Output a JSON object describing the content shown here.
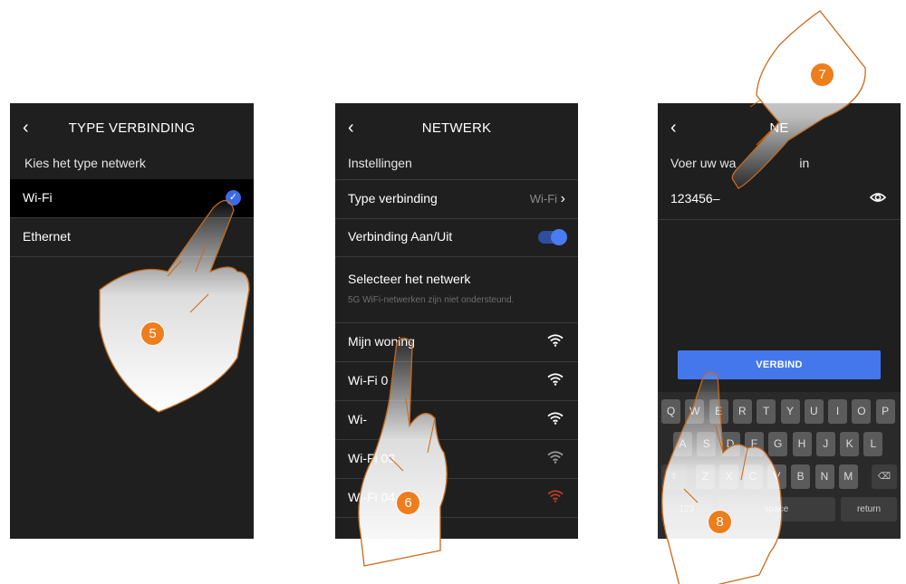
{
  "screen1": {
    "title": "TYPE VERBINDING",
    "subtitle": "Kies het type netwerk",
    "items": [
      {
        "label": "Wi-Fi",
        "selected": true
      },
      {
        "label": "Ethernet",
        "selected": false
      }
    ]
  },
  "screen2": {
    "title": "NETWERK",
    "section": "Instellingen",
    "type_label": "Type verbinding",
    "type_value": "Wi-Fi",
    "toggle_label": "Verbinding Aan/Uit",
    "toggle_on": true,
    "select_label": "Selecteer het netwerk",
    "note": "5G WiFi-netwerken zijn niet ondersteund.",
    "networks": [
      {
        "name": "Mijn woning",
        "color": "#ffffff"
      },
      {
        "name": "Wi-Fi 0",
        "color": "#ffffff"
      },
      {
        "name": "Wi-",
        "color": "#ffffff"
      },
      {
        "name": "Wi-Fi 03",
        "color": "#9a9a9a"
      },
      {
        "name": "Wi-Fi 04",
        "color": "#c0392b"
      }
    ]
  },
  "screen3": {
    "title": "NE",
    "prompt": "Voer uw wa",
    "prompt_end": "in",
    "password": "123456–",
    "connect_label": "VERBIND",
    "keyboard": {
      "row1": [
        "Q",
        "W",
        "E",
        "R",
        "T",
        "Y",
        "U",
        "I",
        "O",
        "P"
      ],
      "row2": [
        "A",
        "S",
        "D",
        "F",
        "G",
        "H",
        "J",
        "K",
        "L"
      ],
      "row3": [
        "Z",
        "X",
        "C",
        "V",
        "B",
        "N",
        "M"
      ],
      "num_key": "123",
      "space_key": "space",
      "return_key": "return"
    }
  },
  "steps": [
    "5",
    "6",
    "7",
    "8"
  ],
  "colors": {
    "accent": "#3b6be3",
    "step": "#ee7d1c",
    "hand_outline": "#c8691a"
  }
}
